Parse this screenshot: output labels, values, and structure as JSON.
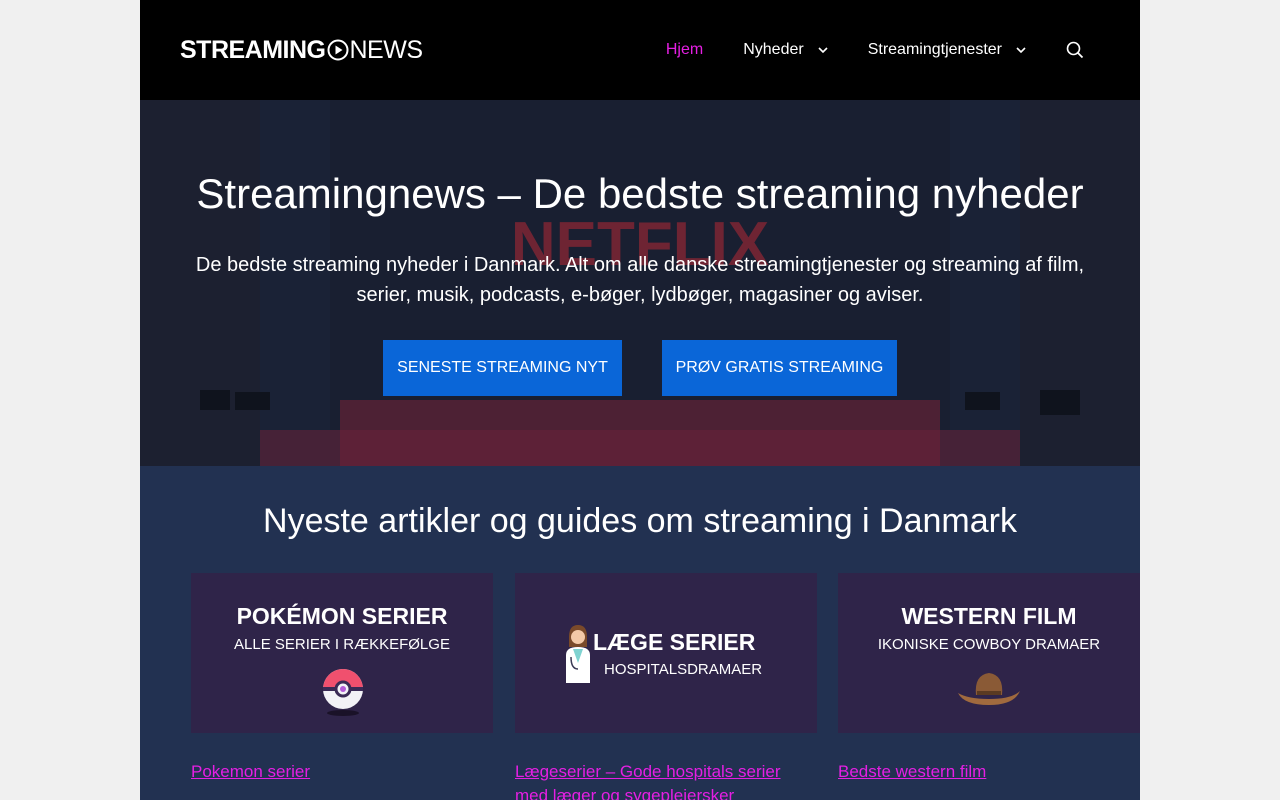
{
  "header": {
    "logo_left": "STREAMING",
    "logo_right": "NEWS",
    "nav": [
      {
        "label": "Hjem",
        "active": true,
        "dropdown": false
      },
      {
        "label": "Nyheder",
        "active": false,
        "dropdown": true
      },
      {
        "label": "Streamingtjenester",
        "active": false,
        "dropdown": true
      }
    ],
    "search_icon": "search-icon"
  },
  "hero": {
    "title": "Streamingnews – De bedste streaming nyheder",
    "text": "De bedste streaming nyheder i Danmark. Alt om alle danske streamingtjenester og streaming af film, serier, musik, podcasts, e-bøger, lydbøger, magasiner og aviser.",
    "background_word": "NETFLIX",
    "buttons": [
      {
        "label": "Seneste streaming nyt"
      },
      {
        "label": "Prøv gratis streaming"
      }
    ]
  },
  "articles": {
    "heading": "Nyeste artikler og guides om streaming i Danmark",
    "items": [
      {
        "thumb_title": "POKÉMON SERIER",
        "thumb_sub": "ALLE SERIER I RÆKKEFØLGE",
        "icon": "pokeball-icon",
        "link": "Pokemon serier"
      },
      {
        "thumb_title": "LÆGE SERIER",
        "thumb_sub": "HOSPITALSDRAMAER",
        "icon": "doctor-icon",
        "link": "Lægeserier – Gode hospitals serier med læger og sygeplejersker"
      },
      {
        "thumb_title": "WESTERN FILM",
        "thumb_sub": "IKONISKE COWBOY DRAMAER",
        "icon": "cowboy-hat-icon",
        "link": "Bedste western film"
      }
    ]
  },
  "colors": {
    "accent": "#e51fe3",
    "button": "#0a66d8",
    "header_bg": "#000000",
    "section_bg": "#223151",
    "thumb_bg": "#2f2449"
  }
}
